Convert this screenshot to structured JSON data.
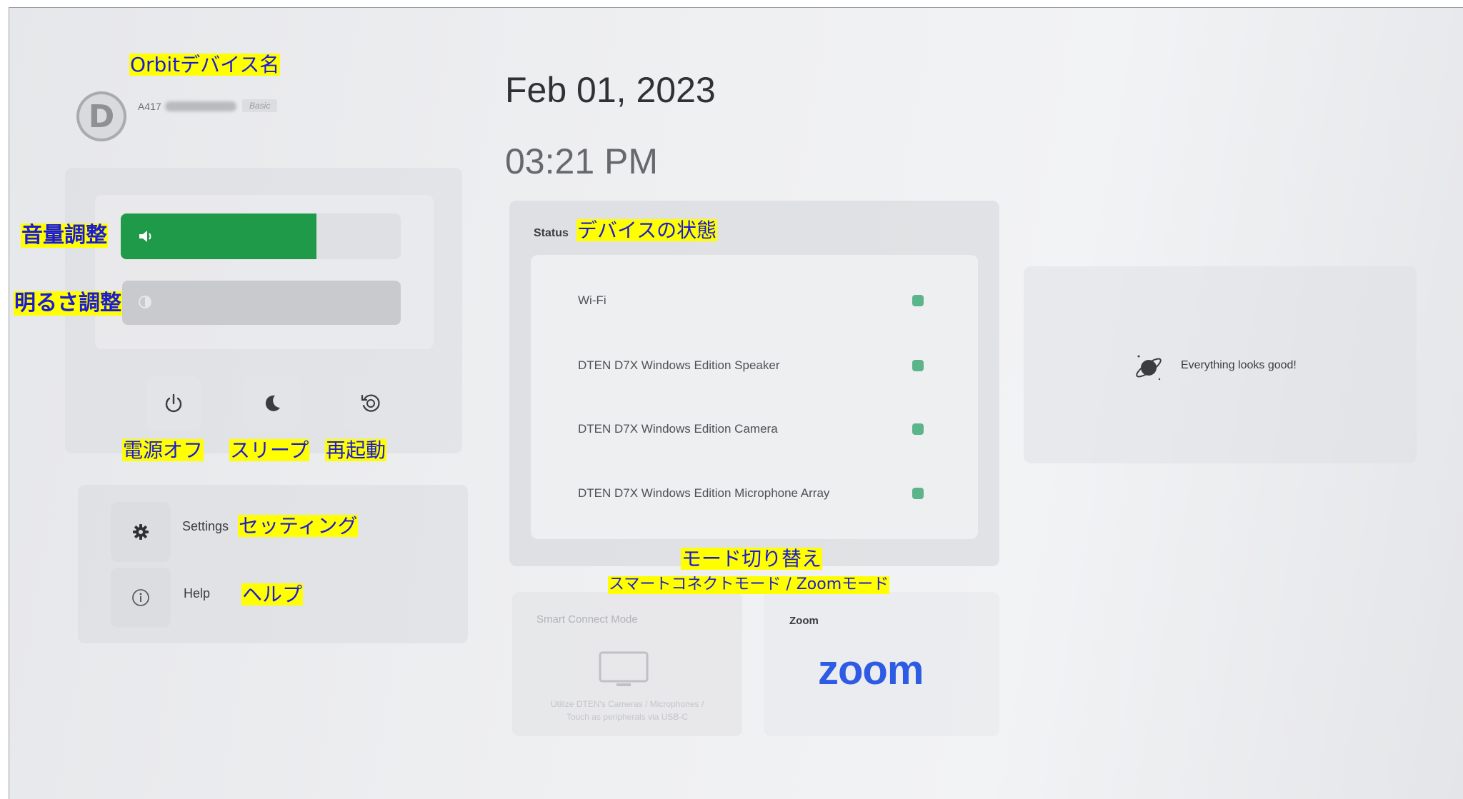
{
  "device": {
    "name": "A417",
    "badge": "Basic"
  },
  "datetime": {
    "date": "Feb 01, 2023",
    "time": "03:21 PM"
  },
  "controls": {
    "volume_level": 0.7,
    "brightness_level": 0.0
  },
  "menu": {
    "settings_label": "Settings",
    "help_label": "Help"
  },
  "status": {
    "title": "Status",
    "items": [
      {
        "label": "Wi-Fi",
        "state": "ok"
      },
      {
        "label": "DTEN D7X Windows Edition Speaker",
        "state": "ok"
      },
      {
        "label": "DTEN D7X Windows Edition Camera",
        "state": "ok"
      },
      {
        "label": "DTEN D7X Windows Edition Microphone Array",
        "state": "ok"
      }
    ],
    "summary": "Everything looks good!"
  },
  "modes": {
    "smart_connect": {
      "title": "Smart Connect Mode",
      "description_line1": "Utilize DTEN's Cameras / Microphones /",
      "description_line2": "Touch as peripherals via USB-C"
    },
    "zoom": {
      "title": "Zoom",
      "logo_text": "zoom"
    }
  },
  "annotations": {
    "device_name": "Orbitデバイス名",
    "volume": "音量調整",
    "brightness": "明るさ調整",
    "power_off": "電源オフ",
    "sleep": "スリープ",
    "restart": "再起動",
    "settings": "セッティング",
    "help": "ヘルプ",
    "status": "デバイスの状態",
    "mode_switch": "モード切り替え",
    "mode_names": "スマートコネクトモード / Zoomモード"
  },
  "colors": {
    "volume_fill": "#1f9a48",
    "status_ok": "#5cb58a",
    "zoom_blue": "#2d5be3",
    "callout_bg": "#ffff00",
    "callout_text": "#1b1bd6"
  },
  "icons": [
    "device-logo-icon",
    "speaker-icon",
    "brightness-icon",
    "power-icon",
    "moon-icon",
    "restart-icon",
    "gear-icon",
    "info-icon",
    "monitor-icon",
    "planet-icon"
  ]
}
